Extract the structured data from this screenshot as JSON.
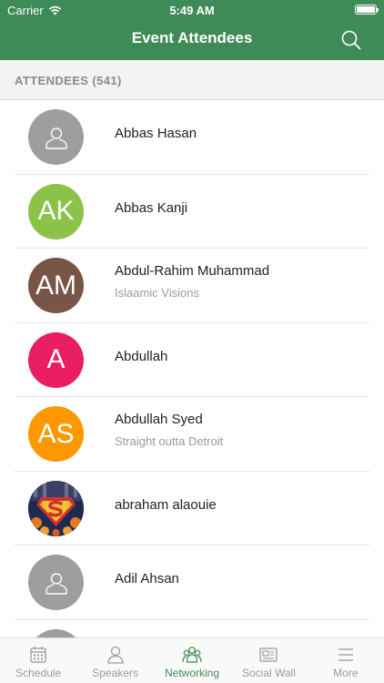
{
  "status_bar": {
    "carrier": "Carrier",
    "time": "5:49 AM"
  },
  "header": {
    "title": "Event Attendees",
    "search_icon": "search-icon",
    "color": "#3f8b57"
  },
  "section": {
    "label": "ATTENDEES (541)"
  },
  "attendees": [
    {
      "name": "Abbas Hasan",
      "subtitle": "",
      "avatar": {
        "type": "placeholder",
        "initials": ""
      }
    },
    {
      "name": "Abbas Kanji",
      "subtitle": "",
      "avatar": {
        "type": "initials",
        "initials": "AK",
        "color": "#8bc34a"
      }
    },
    {
      "name": "Abdul-Rahim Muhammad",
      "subtitle": "Islaamic Visions",
      "avatar": {
        "type": "initials",
        "initials": "AM",
        "color": "#795548"
      }
    },
    {
      "name": "Abdullah",
      "subtitle": "",
      "avatar": {
        "type": "initials",
        "initials": "A",
        "color": "#e91e63"
      }
    },
    {
      "name": "Abdullah Syed",
      "subtitle": "Straight outta Detroit",
      "avatar": {
        "type": "initials",
        "initials": "AS",
        "color": "#ff9800"
      }
    },
    {
      "name": "abraham alaouie",
      "subtitle": "",
      "avatar": {
        "type": "photo",
        "initials": ""
      }
    },
    {
      "name": "Adil Ahsan",
      "subtitle": "",
      "avatar": {
        "type": "placeholder",
        "initials": ""
      }
    },
    {
      "name": "",
      "subtitle": "",
      "avatar": {
        "type": "placeholder",
        "initials": ""
      }
    }
  ],
  "tabs": [
    {
      "label": "Schedule",
      "icon": "calendar-icon",
      "active": false
    },
    {
      "label": "Speakers",
      "icon": "person-icon",
      "active": false
    },
    {
      "label": "Networking",
      "icon": "people-icon",
      "active": true
    },
    {
      "label": "Social Wall",
      "icon": "news-icon",
      "active": false
    },
    {
      "label": "More",
      "icon": "menu-icon",
      "active": false
    }
  ]
}
